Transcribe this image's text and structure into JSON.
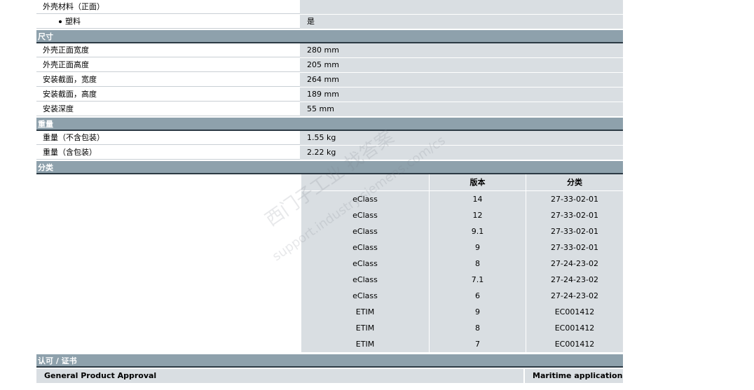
{
  "top_rows": [
    {
      "label": "外壳材料（正面）",
      "value": ""
    },
    {
      "label": "塑料",
      "value": "是"
    }
  ],
  "sections": [
    {
      "title": "尺寸",
      "rows": [
        {
          "label": "外壳正面宽度",
          "value": "280 mm"
        },
        {
          "label": "外壳正面高度",
          "value": "205 mm"
        },
        {
          "label": "安装截面，宽度",
          "value": "264 mm"
        },
        {
          "label": "安装截面，高度",
          "value": "189 mm"
        },
        {
          "label": "安装深度",
          "value": "55 mm"
        }
      ]
    },
    {
      "title": "重量",
      "rows": [
        {
          "label": "重量（不含包装）",
          "value": "1.55 kg"
        },
        {
          "label": "重量（含包装）",
          "value": "2.22 kg"
        }
      ]
    }
  ],
  "classification": {
    "title": "分类",
    "headers": [
      "",
      "版本",
      "分类"
    ],
    "rows": [
      [
        "eClass",
        "14",
        "27-33-02-01"
      ],
      [
        "eClass",
        "12",
        "27-33-02-01"
      ],
      [
        "eClass",
        "9.1",
        "27-33-02-01"
      ],
      [
        "eClass",
        "9",
        "27-33-02-01"
      ],
      [
        "eClass",
        "8",
        "27-24-23-02"
      ],
      [
        "eClass",
        "7.1",
        "27-24-23-02"
      ],
      [
        "eClass",
        "6",
        "27-24-23-02"
      ],
      [
        "ETIM",
        "9",
        "EC001412"
      ],
      [
        "ETIM",
        "8",
        "EC001412"
      ],
      [
        "ETIM",
        "7",
        "EC001412"
      ]
    ]
  },
  "approvals": {
    "title": "认可 / 证书",
    "general": "General Product Approval",
    "maritime": "Maritime application"
  },
  "watermark": {
    "line1": "西门子工业   找答案",
    "line2": "support.industry.siemens.com/cs"
  }
}
